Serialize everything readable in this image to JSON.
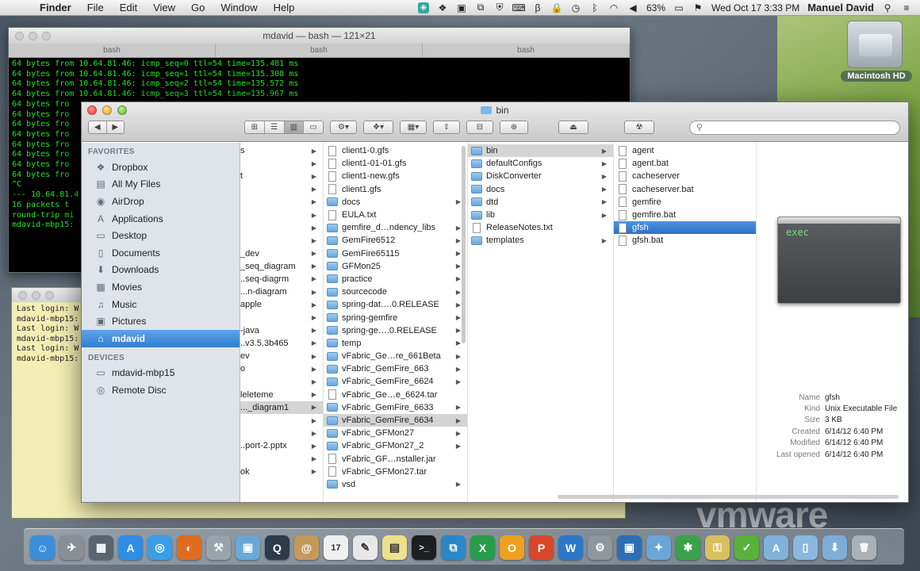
{
  "menubar": {
    "app": "Finder",
    "items": [
      "File",
      "Edit",
      "View",
      "Go",
      "Window",
      "Help"
    ],
    "battery": "63%",
    "clock": "Wed Oct 17  3:33 PM",
    "user": "Manuel David"
  },
  "desktop": {
    "hd_label": "Macintosh HD",
    "watermark": "vmware"
  },
  "terminal": {
    "title": "mdavid — bash — 121×21",
    "tabs": [
      "bash",
      "bash",
      "bash"
    ],
    "lines": [
      "64 bytes from 10.64.81.46: icmp_seq=0 ttl=54 time=135.481 ms",
      "64 bytes from 10.64.81.46: icmp_seq=1 ttl=54 time=135.308 ms",
      "64 bytes from 10.64.81.46: icmp_seq=2 ttl=54 time=135.572 ms",
      "64 bytes from 10.64.81.46: icmp_seq=3 ttl=54 time=135.967 ms",
      "64 bytes fro",
      "64 bytes fro",
      "64 bytes fro",
      "64 bytes fro",
      "64 bytes fro",
      "64 bytes fro",
      "64 bytes fro",
      "64 bytes fro",
      "^C",
      "--- 10.64.81.4",
      "16 packets t",
      "round-trip mi",
      "mdavid-mbp15:"
    ]
  },
  "terminal2": {
    "lines": [
      "Last login: W",
      "mdavid-mbp15:",
      "Last login: W",
      "mdavid-mbp15:",
      "Last login: W",
      "mdavid-mbp15:"
    ]
  },
  "finder": {
    "title": "bin",
    "search_placeholder": "",
    "sidebar": {
      "favorites_header": "FAVORITES",
      "favorites": [
        {
          "label": "Dropbox",
          "icon": "dropbox-icon",
          "glyph": "❖"
        },
        {
          "label": "All My Files",
          "icon": "all-files-icon",
          "glyph": "▤"
        },
        {
          "label": "AirDrop",
          "icon": "airdrop-icon",
          "glyph": "◉"
        },
        {
          "label": "Applications",
          "icon": "applications-icon",
          "glyph": "A"
        },
        {
          "label": "Desktop",
          "icon": "desktop-icon",
          "glyph": "▭"
        },
        {
          "label": "Documents",
          "icon": "documents-icon",
          "glyph": "▯"
        },
        {
          "label": "Downloads",
          "icon": "downloads-icon",
          "glyph": "⬇"
        },
        {
          "label": "Movies",
          "icon": "movies-icon",
          "glyph": "▦"
        },
        {
          "label": "Music",
          "icon": "music-icon",
          "glyph": "♫"
        },
        {
          "label": "Pictures",
          "icon": "pictures-icon",
          "glyph": "▣"
        },
        {
          "label": "mdavid",
          "icon": "home-icon",
          "glyph": "⌂",
          "selected": true
        }
      ],
      "devices_header": "DEVICES",
      "devices": [
        {
          "label": "mdavid-mbp15",
          "icon": "computer-icon",
          "glyph": "▭"
        },
        {
          "label": "Remote Disc",
          "icon": "disc-icon",
          "glyph": "◎"
        }
      ]
    },
    "column1": [
      "s",
      "",
      "t",
      "",
      "",
      "",
      "",
      "",
      "_dev",
      "_seq_diagram",
      "..seq-diagrm",
      "...n-diagram",
      "apple",
      "",
      "-java",
      "..v3.5.3b465",
      "ev",
      "o",
      "",
      "leleteme",
      "..._diagram1",
      "",
      "",
      "..port-2.pptx",
      "",
      "ok"
    ],
    "column2": [
      {
        "name": "client1-0.gfs",
        "type": "file"
      },
      {
        "name": "client1-01-01.gfs",
        "type": "file"
      },
      {
        "name": "client1-new.gfs",
        "type": "file"
      },
      {
        "name": "client1.gfs",
        "type": "file"
      },
      {
        "name": "docs",
        "type": "folder"
      },
      {
        "name": "EULA.txt",
        "type": "file"
      },
      {
        "name": "gemfire_d…ndency_libs",
        "type": "folder"
      },
      {
        "name": "GemFire6512",
        "type": "folder"
      },
      {
        "name": "GemFire65115",
        "type": "folder"
      },
      {
        "name": "GFMon25",
        "type": "folder"
      },
      {
        "name": "practice",
        "type": "folder"
      },
      {
        "name": "sourcecode",
        "type": "folder"
      },
      {
        "name": "spring-dat….0.RELEASE",
        "type": "folder"
      },
      {
        "name": "spring-gemfire",
        "type": "folder"
      },
      {
        "name": "spring-ge….0.RELEASE",
        "type": "folder"
      },
      {
        "name": "temp",
        "type": "folder"
      },
      {
        "name": "vFabric_Ge…re_661Beta",
        "type": "folder"
      },
      {
        "name": "vFabric_GemFire_663",
        "type": "folder"
      },
      {
        "name": "vFabric_GemFire_6624",
        "type": "folder"
      },
      {
        "name": "vFabric_Ge…e_6624.tar",
        "type": "file"
      },
      {
        "name": "vFabric_GemFire_6633",
        "type": "folder"
      },
      {
        "name": "vFabric_GemFire_6634",
        "type": "folder",
        "selected": true
      },
      {
        "name": "vFabric_GFMon27",
        "type": "folder"
      },
      {
        "name": "vFabric_GFMon27_2",
        "type": "folder"
      },
      {
        "name": "vFabric_GF…nstaller.jar",
        "type": "file"
      },
      {
        "name": "vFabric_GFMon27.tar",
        "type": "file"
      },
      {
        "name": "vsd",
        "type": "folder"
      }
    ],
    "column3": [
      {
        "name": "bin",
        "type": "folder",
        "selected": true
      },
      {
        "name": "defaultConfigs",
        "type": "folder"
      },
      {
        "name": "DiskConverter",
        "type": "folder"
      },
      {
        "name": "docs",
        "type": "folder"
      },
      {
        "name": "dtd",
        "type": "folder"
      },
      {
        "name": "lib",
        "type": "folder"
      },
      {
        "name": "ReleaseNotes.txt",
        "type": "file"
      },
      {
        "name": "templates",
        "type": "folder"
      }
    ],
    "column4": [
      {
        "name": "agent",
        "type": "file"
      },
      {
        "name": "agent.bat",
        "type": "file"
      },
      {
        "name": "cacheserver",
        "type": "file"
      },
      {
        "name": "cacheserver.bat",
        "type": "file"
      },
      {
        "name": "gemfire",
        "type": "file"
      },
      {
        "name": "gemfire.bat",
        "type": "file"
      },
      {
        "name": "gfsh",
        "type": "file",
        "selected": true
      },
      {
        "name": "gfsh.bat",
        "type": "file"
      }
    ],
    "preview": {
      "icon_text": "exec",
      "info": [
        {
          "key": "Name",
          "value": "gfsh"
        },
        {
          "key": "Kind",
          "value": "Unix Executable File"
        },
        {
          "key": "Size",
          "value": "3 KB"
        },
        {
          "key": "Created",
          "value": "6/14/12 6:40 PM"
        },
        {
          "key": "Modified",
          "value": "6/14/12 6:40 PM"
        },
        {
          "key": "Last opened",
          "value": "6/14/12 6:40 PM"
        }
      ]
    }
  },
  "dock": [
    {
      "name": "finder-icon",
      "color": "#3b8fd9",
      "glyph": "☺"
    },
    {
      "name": "launchpad-icon",
      "color": "#8a8f96",
      "glyph": "✈"
    },
    {
      "name": "mission-control-icon",
      "color": "#5a6570",
      "glyph": "▦"
    },
    {
      "name": "app-store-icon",
      "color": "#2f8de4",
      "glyph": "A"
    },
    {
      "name": "safari-icon",
      "color": "#3a9ee6",
      "glyph": "◎"
    },
    {
      "name": "firefox-icon",
      "color": "#e06d1f",
      "glyph": "◐"
    },
    {
      "name": "xcode-icon",
      "color": "#9aa3ab",
      "glyph": "⚒"
    },
    {
      "name": "preview-icon",
      "color": "#6aa8d6",
      "glyph": "▣"
    },
    {
      "name": "quicktime-icon",
      "color": "#2d3b4a",
      "glyph": "Q"
    },
    {
      "name": "contacts-icon",
      "color": "#c59a5a",
      "glyph": "@"
    },
    {
      "name": "calendar-icon",
      "color": "#f0f0f0",
      "glyph": "17"
    },
    {
      "name": "textedit-icon",
      "color": "#e8e8e8",
      "glyph": "✎"
    },
    {
      "name": "notes-icon",
      "color": "#efe08c",
      "glyph": "▤"
    },
    {
      "name": "terminal-icon",
      "color": "#1d1f21",
      "glyph": ">_"
    },
    {
      "name": "remote-desktop-icon",
      "color": "#2a87c8",
      "glyph": "⧉"
    },
    {
      "name": "excel-icon",
      "color": "#2a9d4b",
      "glyph": "X"
    },
    {
      "name": "outlook-icon",
      "color": "#f0a020",
      "glyph": "O"
    },
    {
      "name": "powerpoint-icon",
      "color": "#d9472b",
      "glyph": "P"
    },
    {
      "name": "word-icon",
      "color": "#2b78c8",
      "glyph": "W"
    },
    {
      "name": "system-preferences-icon",
      "color": "#8f969c",
      "glyph": "⚙"
    },
    {
      "name": "vmware-icon",
      "color": "#2d6fb5",
      "glyph": "▣"
    },
    {
      "name": "network-utility-icon",
      "color": "#6aa6d6",
      "glyph": "✦"
    },
    {
      "name": "utility-icon",
      "color": "#3aa34a",
      "glyph": "✱"
    },
    {
      "name": "keychain-icon",
      "color": "#d8c060",
      "glyph": "⚿"
    },
    {
      "name": "evernote-icon",
      "color": "#58b33a",
      "glyph": "✓"
    },
    {
      "name": "applications-stack-icon",
      "color": "#7fb2dc",
      "glyph": "A"
    },
    {
      "name": "documents-stack-icon",
      "color": "#8ab8de",
      "glyph": "▯"
    },
    {
      "name": "downloads-stack-icon",
      "color": "#7eaed8",
      "glyph": "⬇"
    },
    {
      "name": "trash-icon",
      "color": "#aab2b8",
      "glyph": "🗑"
    }
  ]
}
